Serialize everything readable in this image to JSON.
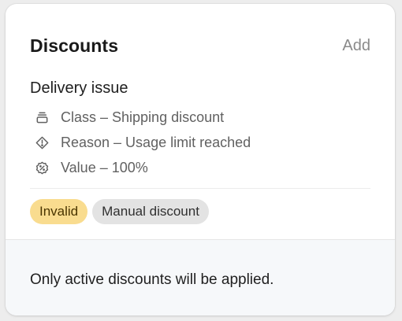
{
  "card": {
    "title": "Discounts",
    "add_label": "Add",
    "discount": {
      "name": "Delivery issue",
      "details": [
        {
          "icon": "stack-icon",
          "text": "Class – Shipping discount"
        },
        {
          "icon": "alert-diamond-icon",
          "text": "Reason – Usage limit reached"
        },
        {
          "icon": "discount-badge-icon",
          "text": "Value – 100%"
        }
      ],
      "badges": [
        {
          "label": "Invalid",
          "color": "#f9dc8f"
        },
        {
          "label": "Manual discount",
          "color": "#e3e3e3"
        }
      ]
    },
    "footer_text": "Only active discounts will be applied."
  }
}
